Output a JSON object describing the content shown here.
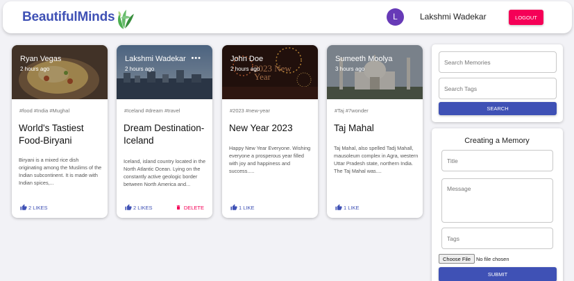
{
  "header": {
    "brand": "BeautifulMinds",
    "avatar_initial": "L",
    "user_name": "Lakshmi Wadekar",
    "logout_label": "LOGOUT",
    "brand_color": "#3f51b5",
    "logout_color": "#f50057"
  },
  "posts": [
    {
      "creator": "Ryan Vegas",
      "time": "2 hours ago",
      "tags": "#food #India #Mughal",
      "title": "World's Tastiest Food-Biryani",
      "message": "Biryani is a mixed rice dish originating among the Muslims of the Indian subcontinent. It is made with Indian spices,...",
      "likes": "2 LIKES",
      "image": "biryani"
    },
    {
      "creator": "Lakshmi Wadekar",
      "time": "2 hours ago",
      "tags": "#Iceland #dream #travel",
      "title": "Dream Destination-Iceland",
      "message": "Iceland, island country located in the North Atlantic Ocean. Lying on the constantly active geologic border between North America and...",
      "likes": "2 LIKES",
      "delete_label": "DELETE",
      "more": "•••",
      "image": "city-skyline"
    },
    {
      "creator": "John Doe",
      "time": "2 hours ago",
      "tags": "#2023 #new-year",
      "title": "New Year 2023",
      "message": "Happy New Year Everyone. Wishing everyone a prosperous year filled with joy and happiness and success.....",
      "likes": "1 LIKE",
      "image": "fireworks",
      "image_text": "2023 New Year"
    },
    {
      "creator": "Sumeeth Moolya",
      "time": "3 hours ago",
      "tags": "#Taj #7wonder",
      "title": "Taj Mahal",
      "message": "Taj Mahal, also spelled Tadj Mahall, mausoleum complex in Agra, western Uttar Pradesh state, northern India. The Taj Mahal was....",
      "likes": "1 LIKE",
      "image": "taj-mahal"
    }
  ],
  "search": {
    "memories_placeholder": "Search Memories",
    "tags_placeholder": "Search Tags",
    "button": "SEARCH"
  },
  "form": {
    "heading": "Creating a Memory",
    "title_placeholder": "Title",
    "message_placeholder": "Message",
    "tags_placeholder": "Tags",
    "file_button": "Choose File",
    "file_status": "No file chosen",
    "submit": "SUBMIT"
  }
}
